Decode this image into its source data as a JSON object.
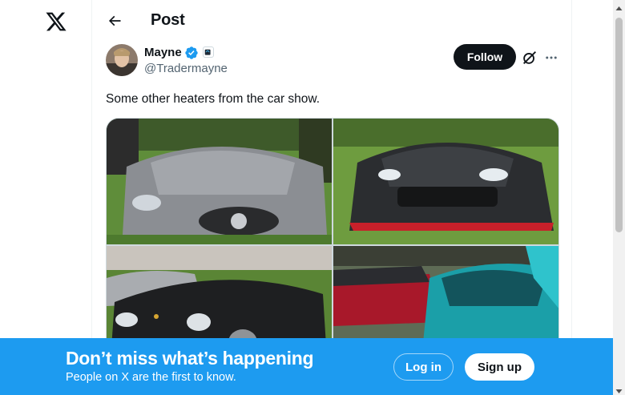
{
  "nav": {
    "logo_icon": "x-logo-icon"
  },
  "header": {
    "title": "Post",
    "back_icon": "arrow-left-icon"
  },
  "tweet": {
    "author_name": "Mayne",
    "handle": "@Tradermayne",
    "verified_color": "#1d9bf0",
    "follow_label": "Follow",
    "text": "Some other heaters from the car show.",
    "media": [
      {
        "subject": "silver-mercedes-sls-photo"
      },
      {
        "subject": "black-nissan-gtr-photo"
      },
      {
        "subject": "black-porsche-911-photo"
      },
      {
        "subject": "teal-honda-crx-photo"
      }
    ]
  },
  "banner": {
    "title": "Don’t miss what’s happening",
    "subtitle": "People on X are the first to know.",
    "login_label": "Log in",
    "signup_label": "Sign up",
    "color": "#1d9bf0"
  }
}
